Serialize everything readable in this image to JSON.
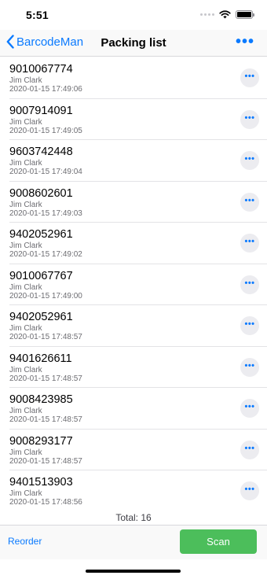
{
  "status_bar": {
    "time": "5:51",
    "icons": [
      "signal-icon",
      "wifi-icon",
      "battery-icon"
    ]
  },
  "nav": {
    "back_label": "BarcodeMan",
    "title": "Packing list",
    "more_icon": "more-horizontal-icon"
  },
  "items": [
    {
      "code": "9010067774",
      "user": "Jim Clark",
      "time": "2020-01-15 17:49:06"
    },
    {
      "code": "9007914091",
      "user": "Jim Clark",
      "time": "2020-01-15 17:49:05"
    },
    {
      "code": "9603742448",
      "user": "Jim Clark",
      "time": "2020-01-15 17:49:04"
    },
    {
      "code": "9008602601",
      "user": "Jim Clark",
      "time": "2020-01-15 17:49:03"
    },
    {
      "code": "9402052961",
      "user": "Jim Clark",
      "time": "2020-01-15 17:49:02"
    },
    {
      "code": "9010067767",
      "user": "Jim Clark",
      "time": "2020-01-15 17:49:00"
    },
    {
      "code": "9402052961",
      "user": "Jim Clark",
      "time": "2020-01-15 17:48:57"
    },
    {
      "code": "9401626611",
      "user": "Jim Clark",
      "time": "2020-01-15 17:48:57"
    },
    {
      "code": "9008423985",
      "user": "Jim Clark",
      "time": "2020-01-15 17:48:57"
    },
    {
      "code": "9008293177",
      "user": "Jim Clark",
      "time": "2020-01-15 17:48:57"
    },
    {
      "code": "9401513903",
      "user": "Jim Clark",
      "time": "2020-01-15 17:48:56"
    }
  ],
  "total_label": "Total: 16",
  "toolbar": {
    "reorder_label": "Reorder",
    "scan_label": "Scan"
  },
  "colors": {
    "accent": "#0a7aff",
    "scan_button": "#4cbe5b",
    "secondary_text": "#6d6d72"
  }
}
